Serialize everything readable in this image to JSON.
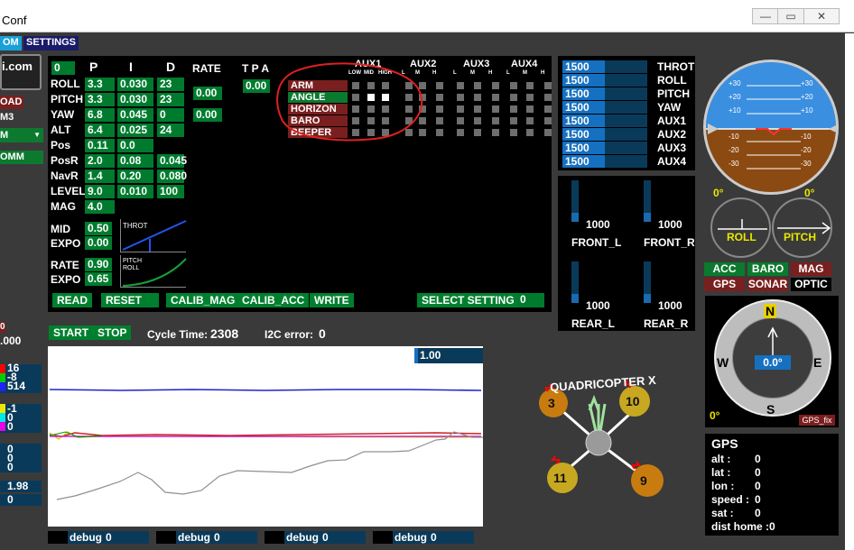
{
  "window": {
    "title": "Conf",
    "minimize": "—",
    "maximize": "▭",
    "close": "✕"
  },
  "menu": {
    "items": [
      "OM",
      "SETTINGS"
    ]
  },
  "left_strip": {
    "site": "i.com",
    "load": "OAD",
    "m3": "M3",
    "m_label": "M",
    "omm": "OMM",
    "zero_box": "0",
    "val_000": ".000",
    "v1": "16",
    "v2": "-8",
    "v3": "514",
    "v4": "-1",
    "v5": "0",
    "v6": "0",
    "v7": "0",
    "v8": "0",
    "v9": "0",
    "v10": "1.98",
    "v11": "0"
  },
  "pid": {
    "profile": "0",
    "col_p": "P",
    "col_i": "I",
    "col_d": "D",
    "col_rate": "RATE",
    "col_tpa": "T P A",
    "rows": [
      {
        "name": "ROLL",
        "p": "3.3",
        "i": "0.030",
        "d": "23"
      },
      {
        "name": "PITCH",
        "p": "3.3",
        "i": "0.030",
        "d": "23"
      },
      {
        "name": "YAW",
        "p": "6.8",
        "i": "0.045",
        "d": "0"
      },
      {
        "name": "ALT",
        "p": "6.4",
        "i": "0.025",
        "d": "24"
      },
      {
        "name": "Pos",
        "p": "0.11",
        "i": "0.0",
        "d": ""
      },
      {
        "name": "PosR",
        "p": "2.0",
        "i": "0.08",
        "d": "0.045"
      },
      {
        "name": "NavR",
        "p": "1.4",
        "i": "0.20",
        "d": "0.080"
      },
      {
        "name": "LEVEL",
        "p": "9.0",
        "i": "0.010",
        "d": "100"
      },
      {
        "name": "MAG",
        "p": "4.0",
        "i": "",
        "d": ""
      }
    ],
    "rate_rp": "0.00",
    "rate_yaw": "0.00",
    "tpa": "0.00",
    "mid_label": "MID",
    "mid": "0.50",
    "expo_label": "EXPO",
    "expo": "0.00",
    "throt_label": "THROT",
    "rate_label": "RATE",
    "rate2": "0.90",
    "expo2_label": "EXPO",
    "expo2": "0.65",
    "pitchroll_label1": "PITCH",
    "pitchroll_label2": "ROLL"
  },
  "aux": {
    "headers": [
      "AUX1",
      "AUX2",
      "AUX3",
      "AUX4"
    ],
    "sub1": [
      "LOW",
      "MID",
      "HIGH"
    ],
    "sub": [
      "L",
      "M",
      "H"
    ],
    "boxes": [
      {
        "name": "ARM",
        "active": false,
        "on": []
      },
      {
        "name": "ANGLE",
        "active": true,
        "on": [
          1,
          2
        ]
      },
      {
        "name": "HORIZON",
        "active": false,
        "on": []
      },
      {
        "name": "BARO",
        "active": false,
        "on": []
      },
      {
        "name": "BEEPER",
        "active": false,
        "on": []
      }
    ]
  },
  "buttons": {
    "read": "READ",
    "reset": "RESET",
    "calib_mag": "CALIB_MAG",
    "calib_acc": "CALIB_ACC",
    "write": "WRITE",
    "select_setting": "SELECT SETTING",
    "setting_val": "0",
    "start": "START",
    "stop": "STOP"
  },
  "status": {
    "cycle_label": "Cycle Time:",
    "cycle_val": "2308",
    "i2c_label": "I2C error:",
    "i2c_val": "0"
  },
  "graph": {
    "scale": "1.00",
    "debug_labels": [
      "debug",
      "debug",
      "debug",
      "debug"
    ],
    "debug_vals": [
      "0",
      "0",
      "0",
      "0"
    ]
  },
  "rc": {
    "channels": [
      {
        "name": "THROT",
        "value": "1500",
        "fraction": 0.5
      },
      {
        "name": "ROLL",
        "value": "1500",
        "fraction": 0.5
      },
      {
        "name": "PITCH",
        "value": "1500",
        "fraction": 0.5
      },
      {
        "name": "YAW",
        "value": "1500",
        "fraction": 0.5
      },
      {
        "name": "AUX1",
        "value": "1500",
        "fraction": 0.5
      },
      {
        "name": "AUX2",
        "value": "1500",
        "fraction": 0.5
      },
      {
        "name": "AUX3",
        "value": "1500",
        "fraction": 0.5
      },
      {
        "name": "AUX4",
        "value": "1500",
        "fraction": 0.5
      }
    ]
  },
  "motors": [
    {
      "name": "FRONT_L",
      "value": "1000"
    },
    {
      "name": "FRONT_R",
      "value": "1000"
    },
    {
      "name": "REAR_L",
      "value": "1000"
    },
    {
      "name": "REAR_R",
      "value": "1000"
    }
  ],
  "quad": {
    "title": "QUADRICOPTER X",
    "m_fl": "3",
    "m_fr": "10",
    "m_rl": "11",
    "m_rr": "9"
  },
  "horizon": {
    "ticks_left": [
      "+30",
      "+20",
      "+10",
      "-10",
      "-20",
      "-30"
    ],
    "ticks_right": [
      "+30",
      "+20",
      "+10",
      "-10",
      "-20",
      "-30"
    ],
    "roll_deg": "0°",
    "pitch_deg": "0°",
    "roll_label": "ROLL",
    "pitch_label": "PITCH"
  },
  "sensors": [
    {
      "name": "ACC",
      "state": "on"
    },
    {
      "name": "BARO",
      "state": "on"
    },
    {
      "name": "MAG",
      "state": "off"
    },
    {
      "name": "GPS",
      "state": "off"
    },
    {
      "name": "SONAR",
      "state": "off"
    },
    {
      "name": "OPTIC",
      "state": "none"
    }
  ],
  "compass": {
    "n": "N",
    "s": "S",
    "e": "E",
    "w": "W",
    "heading": "0.0°",
    "left_val": "0°",
    "gps_fix": "GPS_fix"
  },
  "gps": {
    "title": "GPS",
    "rows": [
      {
        "label": "alt  :",
        "value": "0"
      },
      {
        "label": "lat  :",
        "value": "0"
      },
      {
        "label": "lon  :",
        "value": "0"
      },
      {
        "label": "speed :",
        "value": "0"
      },
      {
        "label": "sat  :",
        "value": "0"
      },
      {
        "label": "dist home :",
        "value": "0"
      }
    ]
  },
  "colors": {
    "green": "#007b2e",
    "red": "#7a1f1f",
    "blue": "#1570c0",
    "sky": "#3a8fe0",
    "ground": "#8b4a12"
  }
}
